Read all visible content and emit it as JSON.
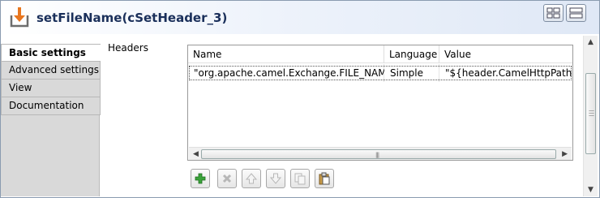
{
  "header": {
    "title": "setFileName(cSetHeader_3)"
  },
  "tabs": [
    {
      "label": "Basic settings",
      "active": true
    },
    {
      "label": "Advanced settings",
      "active": false
    },
    {
      "label": "View",
      "active": false
    },
    {
      "label": "Documentation",
      "active": false
    }
  ],
  "section": {
    "label": "Headers"
  },
  "table": {
    "columns": [
      "Name",
      "Language",
      "Value"
    ],
    "rows": [
      {
        "name": "\"org.apache.camel.Exchange.FILE_NAME\"",
        "language": "Simple",
        "value": "\"${header.CamelHttpPath}\""
      }
    ]
  },
  "toolbar_icons": [
    "add-icon",
    "delete-icon",
    "move-up-icon",
    "move-down-icon",
    "copy-icon",
    "paste-icon"
  ],
  "colors": {
    "title": "#1a2f5a",
    "add_green": "#3aa33a"
  }
}
